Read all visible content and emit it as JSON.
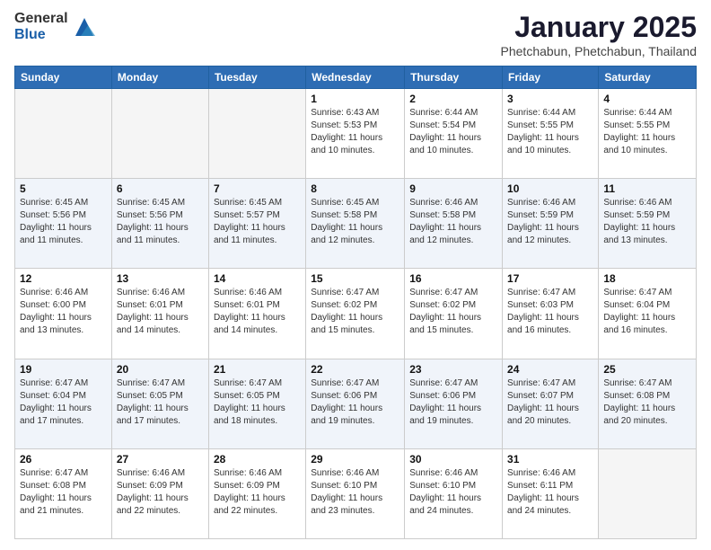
{
  "logo": {
    "general": "General",
    "blue": "Blue"
  },
  "header": {
    "title": "January 2025",
    "subtitle": "Phetchabun, Phetchabun, Thailand"
  },
  "weekdays": [
    "Sunday",
    "Monday",
    "Tuesday",
    "Wednesday",
    "Thursday",
    "Friday",
    "Saturday"
  ],
  "weeks": [
    [
      {
        "day": "",
        "sunrise": "",
        "sunset": "",
        "daylight": "",
        "empty": true
      },
      {
        "day": "",
        "sunrise": "",
        "sunset": "",
        "daylight": "",
        "empty": true
      },
      {
        "day": "",
        "sunrise": "",
        "sunset": "",
        "daylight": "",
        "empty": true
      },
      {
        "day": "1",
        "sunrise": "Sunrise: 6:43 AM",
        "sunset": "Sunset: 5:53 PM",
        "daylight": "Daylight: 11 hours and 10 minutes.",
        "empty": false
      },
      {
        "day": "2",
        "sunrise": "Sunrise: 6:44 AM",
        "sunset": "Sunset: 5:54 PM",
        "daylight": "Daylight: 11 hours and 10 minutes.",
        "empty": false
      },
      {
        "day": "3",
        "sunrise": "Sunrise: 6:44 AM",
        "sunset": "Sunset: 5:55 PM",
        "daylight": "Daylight: 11 hours and 10 minutes.",
        "empty": false
      },
      {
        "day": "4",
        "sunrise": "Sunrise: 6:44 AM",
        "sunset": "Sunset: 5:55 PM",
        "daylight": "Daylight: 11 hours and 10 minutes.",
        "empty": false
      }
    ],
    [
      {
        "day": "5",
        "sunrise": "Sunrise: 6:45 AM",
        "sunset": "Sunset: 5:56 PM",
        "daylight": "Daylight: 11 hours and 11 minutes.",
        "empty": false
      },
      {
        "day": "6",
        "sunrise": "Sunrise: 6:45 AM",
        "sunset": "Sunset: 5:56 PM",
        "daylight": "Daylight: 11 hours and 11 minutes.",
        "empty": false
      },
      {
        "day": "7",
        "sunrise": "Sunrise: 6:45 AM",
        "sunset": "Sunset: 5:57 PM",
        "daylight": "Daylight: 11 hours and 11 minutes.",
        "empty": false
      },
      {
        "day": "8",
        "sunrise": "Sunrise: 6:45 AM",
        "sunset": "Sunset: 5:58 PM",
        "daylight": "Daylight: 11 hours and 12 minutes.",
        "empty": false
      },
      {
        "day": "9",
        "sunrise": "Sunrise: 6:46 AM",
        "sunset": "Sunset: 5:58 PM",
        "daylight": "Daylight: 11 hours and 12 minutes.",
        "empty": false
      },
      {
        "day": "10",
        "sunrise": "Sunrise: 6:46 AM",
        "sunset": "Sunset: 5:59 PM",
        "daylight": "Daylight: 11 hours and 12 minutes.",
        "empty": false
      },
      {
        "day": "11",
        "sunrise": "Sunrise: 6:46 AM",
        "sunset": "Sunset: 5:59 PM",
        "daylight": "Daylight: 11 hours and 13 minutes.",
        "empty": false
      }
    ],
    [
      {
        "day": "12",
        "sunrise": "Sunrise: 6:46 AM",
        "sunset": "Sunset: 6:00 PM",
        "daylight": "Daylight: 11 hours and 13 minutes.",
        "empty": false
      },
      {
        "day": "13",
        "sunrise": "Sunrise: 6:46 AM",
        "sunset": "Sunset: 6:01 PM",
        "daylight": "Daylight: 11 hours and 14 minutes.",
        "empty": false
      },
      {
        "day": "14",
        "sunrise": "Sunrise: 6:46 AM",
        "sunset": "Sunset: 6:01 PM",
        "daylight": "Daylight: 11 hours and 14 minutes.",
        "empty": false
      },
      {
        "day": "15",
        "sunrise": "Sunrise: 6:47 AM",
        "sunset": "Sunset: 6:02 PM",
        "daylight": "Daylight: 11 hours and 15 minutes.",
        "empty": false
      },
      {
        "day": "16",
        "sunrise": "Sunrise: 6:47 AM",
        "sunset": "Sunset: 6:02 PM",
        "daylight": "Daylight: 11 hours and 15 minutes.",
        "empty": false
      },
      {
        "day": "17",
        "sunrise": "Sunrise: 6:47 AM",
        "sunset": "Sunset: 6:03 PM",
        "daylight": "Daylight: 11 hours and 16 minutes.",
        "empty": false
      },
      {
        "day": "18",
        "sunrise": "Sunrise: 6:47 AM",
        "sunset": "Sunset: 6:04 PM",
        "daylight": "Daylight: 11 hours and 16 minutes.",
        "empty": false
      }
    ],
    [
      {
        "day": "19",
        "sunrise": "Sunrise: 6:47 AM",
        "sunset": "Sunset: 6:04 PM",
        "daylight": "Daylight: 11 hours and 17 minutes.",
        "empty": false
      },
      {
        "day": "20",
        "sunrise": "Sunrise: 6:47 AM",
        "sunset": "Sunset: 6:05 PM",
        "daylight": "Daylight: 11 hours and 17 minutes.",
        "empty": false
      },
      {
        "day": "21",
        "sunrise": "Sunrise: 6:47 AM",
        "sunset": "Sunset: 6:05 PM",
        "daylight": "Daylight: 11 hours and 18 minutes.",
        "empty": false
      },
      {
        "day": "22",
        "sunrise": "Sunrise: 6:47 AM",
        "sunset": "Sunset: 6:06 PM",
        "daylight": "Daylight: 11 hours and 19 minutes.",
        "empty": false
      },
      {
        "day": "23",
        "sunrise": "Sunrise: 6:47 AM",
        "sunset": "Sunset: 6:06 PM",
        "daylight": "Daylight: 11 hours and 19 minutes.",
        "empty": false
      },
      {
        "day": "24",
        "sunrise": "Sunrise: 6:47 AM",
        "sunset": "Sunset: 6:07 PM",
        "daylight": "Daylight: 11 hours and 20 minutes.",
        "empty": false
      },
      {
        "day": "25",
        "sunrise": "Sunrise: 6:47 AM",
        "sunset": "Sunset: 6:08 PM",
        "daylight": "Daylight: 11 hours and 20 minutes.",
        "empty": false
      }
    ],
    [
      {
        "day": "26",
        "sunrise": "Sunrise: 6:47 AM",
        "sunset": "Sunset: 6:08 PM",
        "daylight": "Daylight: 11 hours and 21 minutes.",
        "empty": false
      },
      {
        "day": "27",
        "sunrise": "Sunrise: 6:46 AM",
        "sunset": "Sunset: 6:09 PM",
        "daylight": "Daylight: 11 hours and 22 minutes.",
        "empty": false
      },
      {
        "day": "28",
        "sunrise": "Sunrise: 6:46 AM",
        "sunset": "Sunset: 6:09 PM",
        "daylight": "Daylight: 11 hours and 22 minutes.",
        "empty": false
      },
      {
        "day": "29",
        "sunrise": "Sunrise: 6:46 AM",
        "sunset": "Sunset: 6:10 PM",
        "daylight": "Daylight: 11 hours and 23 minutes.",
        "empty": false
      },
      {
        "day": "30",
        "sunrise": "Sunrise: 6:46 AM",
        "sunset": "Sunset: 6:10 PM",
        "daylight": "Daylight: 11 hours and 24 minutes.",
        "empty": false
      },
      {
        "day": "31",
        "sunrise": "Sunrise: 6:46 AM",
        "sunset": "Sunset: 6:11 PM",
        "daylight": "Daylight: 11 hours and 24 minutes.",
        "empty": false
      },
      {
        "day": "",
        "sunrise": "",
        "sunset": "",
        "daylight": "",
        "empty": true
      }
    ]
  ]
}
